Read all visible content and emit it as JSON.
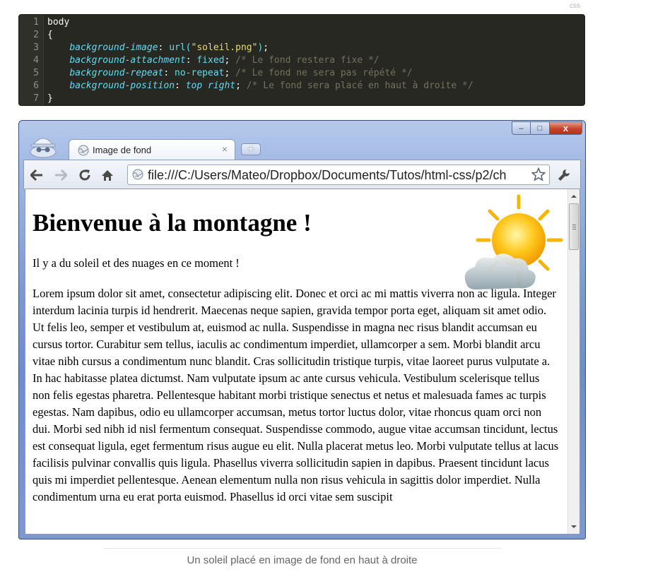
{
  "code_block": {
    "language": "css",
    "lines": [
      {
        "n": "1",
        "selector": "body"
      },
      {
        "n": "2",
        "brace": "{"
      },
      {
        "n": "3",
        "prop": "background-image",
        "fn": "url(",
        "str": "\"soleil.png\"",
        "fn_end": ")",
        "end": ";"
      },
      {
        "n": "4",
        "prop": "background-attachment",
        "value": "fixed",
        "end": ";",
        "comment": "/* Le fond restera fixe */"
      },
      {
        "n": "5",
        "prop": "background-repeat",
        "value": "no-repeat",
        "end": ";",
        "comment": "/* Le fond ne sera pas répété */"
      },
      {
        "n": "6",
        "prop": "background-position",
        "value": "top right",
        "end": ";",
        "comment": "/* Le fond sera placé en haut à droite */"
      },
      {
        "n": "7",
        "brace": "}"
      }
    ]
  },
  "browser": {
    "tab_title": "Image de fond",
    "tab_close": "×",
    "new_tab": "+",
    "url": "file:///C:/Users/Mateo/Dropbox/Documents/Tutos/html-css/p2/ch",
    "window_buttons": {
      "minimize": "–",
      "maximize": "□",
      "close": "x"
    },
    "icons": [
      "incognito-icon",
      "back-icon",
      "forward-icon",
      "reload-icon",
      "home-icon",
      "globe-icon",
      "star-icon",
      "wrench-icon",
      "sun-cloud-icon"
    ]
  },
  "page": {
    "heading": "Bienvenue à la montagne !",
    "intro": "Il y a du soleil et des nuages en ce moment !",
    "body": "Lorem ipsum dolor sit amet, consectetur adipiscing elit. Donec et orci ac mi mattis viverra non ac ligula. Integer interdum lacinia turpis id hendrerit. Maecenas neque sapien, gravida tempor porta eget, aliquam sit amet odio. Ut felis leo, semper et vestibulum at, euismod ac nulla. Suspendisse in magna nec risus blandit accumsan eu cursus tortor. Curabitur sem tellus, iaculis ac condimentum imperdiet, ullamcorper a sem. Morbi blandit arcu vitae nibh cursus a condimentum nunc blandit. Cras sollicitudin tristique turpis, vitae laoreet purus vulputate a. In hac habitasse platea dictumst. Nam vulputate ipsum ac ante cursus vehicula. Vestibulum scelerisque tellus non felis egestas pharetra. Pellentesque habitant morbi tristique senectus et netus et malesuada fames ac turpis egestas. Nam dapibus, odio eu ullamcorper accumsan, metus tortor luctus dolor, vitae rhoncus quam orci non dui. Morbi sed nibh id nisl fermentum consequat. Suspendisse commodo, augue vitae accumsan tincidunt, lectus est consequat ligula, eget fermentum risus augue eu elit. Nulla placerat metus leo. Morbi vulputate tellus at lacus facilisis pulvinar convallis quis ligula. Phasellus viverra sollicitudin sapien in dapibus. Praesent tincidunt lacus quis mi imperdiet pellentesque. Aenean elementum nulla non risus vehicula in sagittis dolor imperdiet. Nulla condimentum urna eu erat porta euismod. Phasellus id orci vitae sem suscipit"
  },
  "caption": "Un soleil placé en image de fond en haut à droite",
  "colors": {
    "code_bg": "#272822",
    "property": "#66d9ef",
    "string": "#e6db74",
    "comment": "#75715e",
    "window_frame": "#7e9ad2",
    "close_button": "#c5432a"
  }
}
